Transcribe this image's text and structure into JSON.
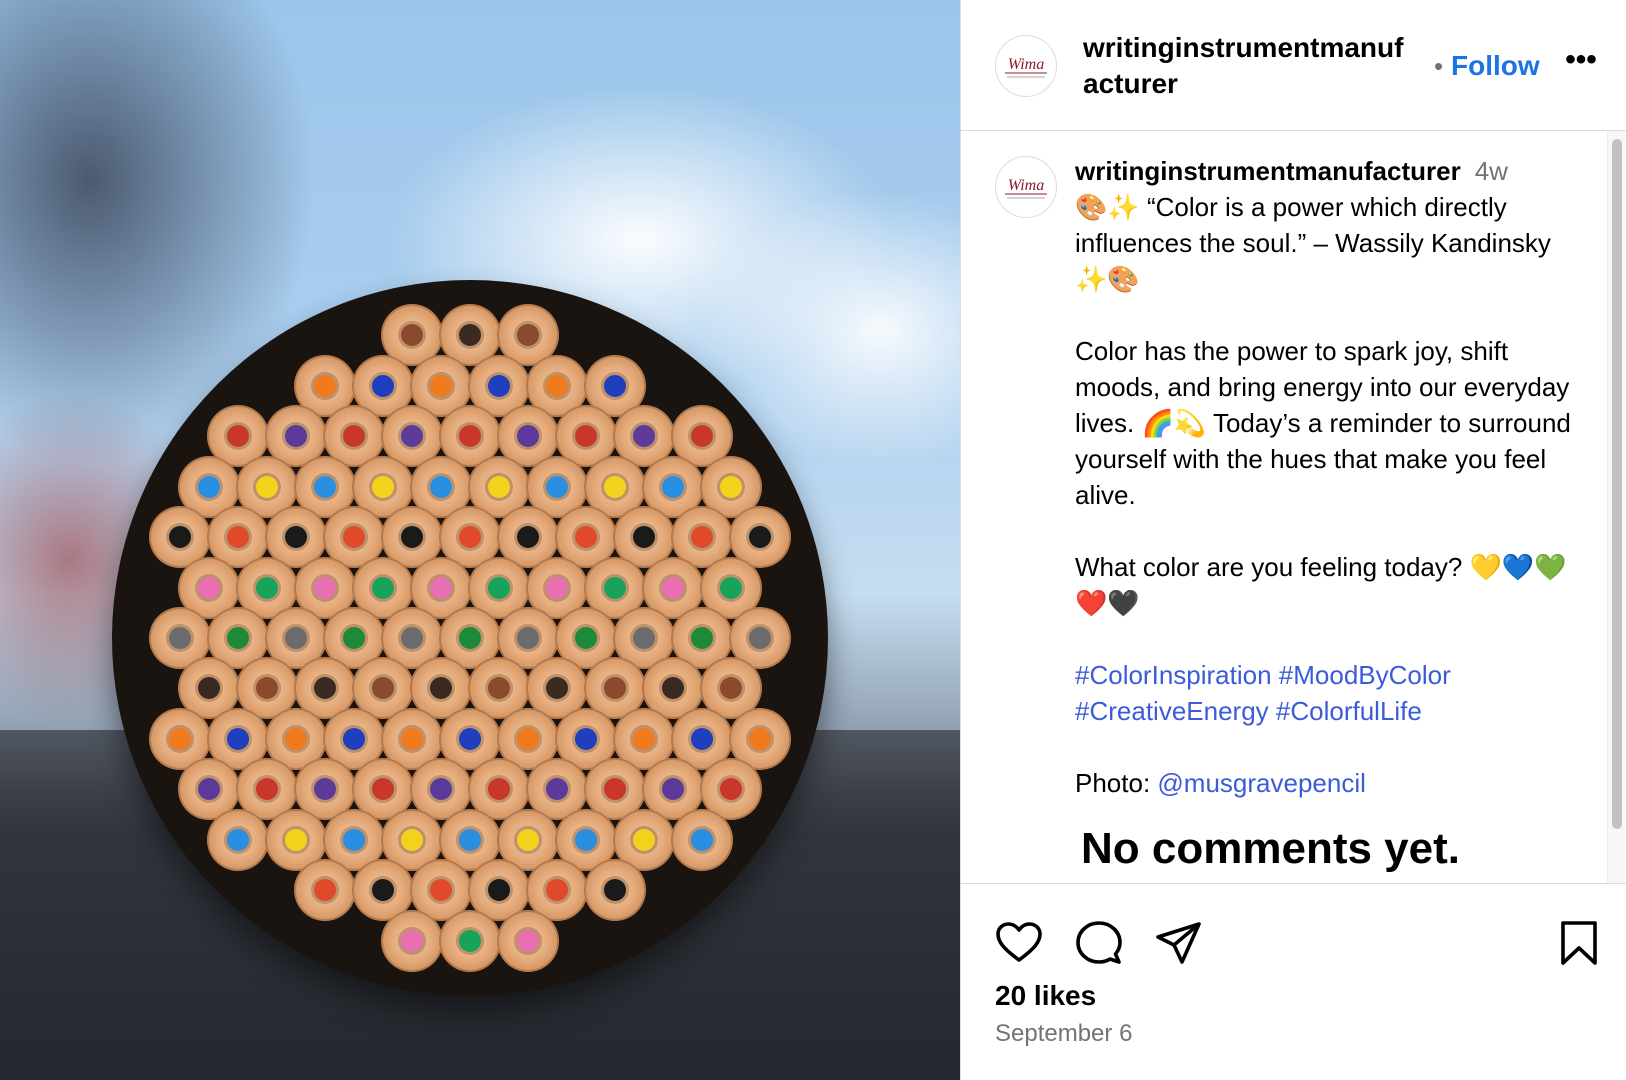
{
  "post": {
    "username_header": "writinginstrumentmanufacturer",
    "follow_dot": "•",
    "follow_label": "Follow",
    "more_label": "•••",
    "avatar_icon": "wima-logo-icon",
    "avatar_logo_text": "Wima"
  },
  "caption": {
    "author": "writinginstrumentmanufacturer",
    "time": "4w",
    "line1": "🎨✨ “Color is a power which directly influences the soul.” – Wassily Kandinsky ✨🎨",
    "para2": "Color has the power to spark joy, shift moods, and bring energy into our everyday lives. 🌈💫 Today’s a reminder to surround yourself with the hues that make you feel alive.",
    "para3": "What color are you feeling today? 💛💙💚❤️🖤",
    "hashtags": [
      "#ColorInspiration",
      "#MoodByColor",
      "#CreativeEnergy",
      "#ColorfulLife"
    ],
    "photo_prefix": "Photo:",
    "photo_mention": "@musgravepencil"
  },
  "comments": {
    "empty_label": "No comments yet."
  },
  "actions": {
    "like_icon": "heart-icon",
    "comment_icon": "comment-bubble-icon",
    "share_icon": "paper-plane-icon",
    "save_icon": "bookmark-icon",
    "likes_label": "20 likes",
    "date_label": "September 6"
  },
  "colors": {
    "link": "#1b74e4",
    "hashtag": "#3b5bdb",
    "muted": "#737373",
    "border": "#dbdbdb"
  }
}
